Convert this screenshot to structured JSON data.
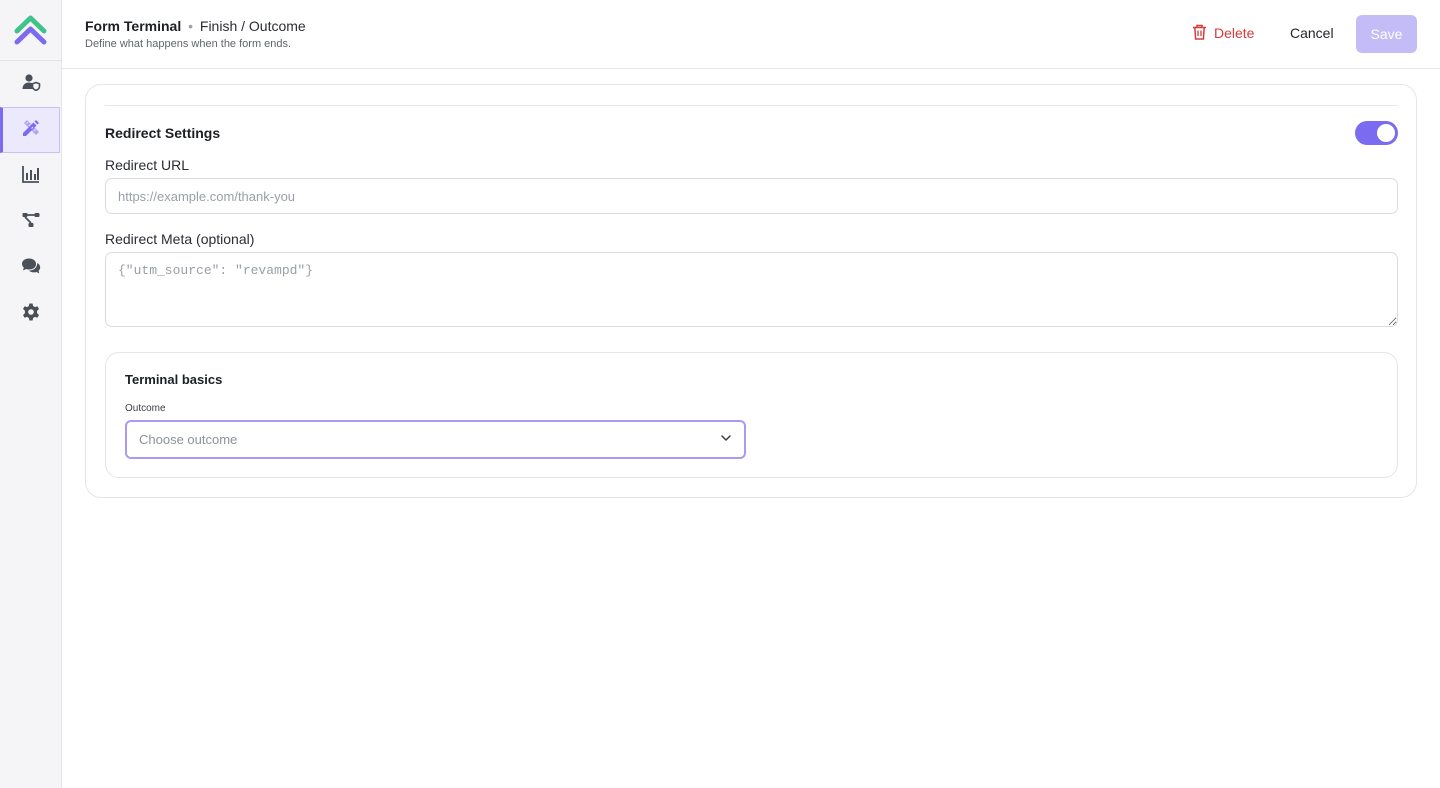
{
  "sidebar": {
    "logo": "chevrons-up-logo",
    "items": [
      {
        "icon": "user-shield-icon",
        "active": false
      },
      {
        "icon": "pencil-ruler-icon",
        "active": true
      },
      {
        "icon": "bar-chart-icon",
        "active": false
      },
      {
        "icon": "flow-diagram-icon",
        "active": false
      },
      {
        "icon": "chat-bubbles-icon",
        "active": false
      },
      {
        "icon": "gear-icon",
        "active": false
      }
    ]
  },
  "header": {
    "title_strong": "Form Terminal",
    "title_separator": "•",
    "title_rest": "Finish / Outcome",
    "subtitle": "Define what happens when the form ends.",
    "delete_label": "Delete",
    "cancel_label": "Cancel",
    "save_label": "Save"
  },
  "redirect": {
    "section_title": "Redirect Settings",
    "enabled": true,
    "url_label": "Redirect URL",
    "url_value": "",
    "url_placeholder": "https://example.com/thank-you",
    "meta_label": "Redirect Meta (optional)",
    "meta_value": "",
    "meta_placeholder": "{\"utm_source\": \"revampd\"}"
  },
  "terminal": {
    "title": "Terminal basics",
    "outcome_label": "Outcome",
    "outcome_placeholder": "Choose outcome"
  },
  "colors": {
    "accent": "#7b6bf0",
    "accent_light": "#c3bcf6",
    "danger": "#d63b3b",
    "logo_green": "#3ec48a",
    "logo_purple": "#7b6bf0"
  }
}
